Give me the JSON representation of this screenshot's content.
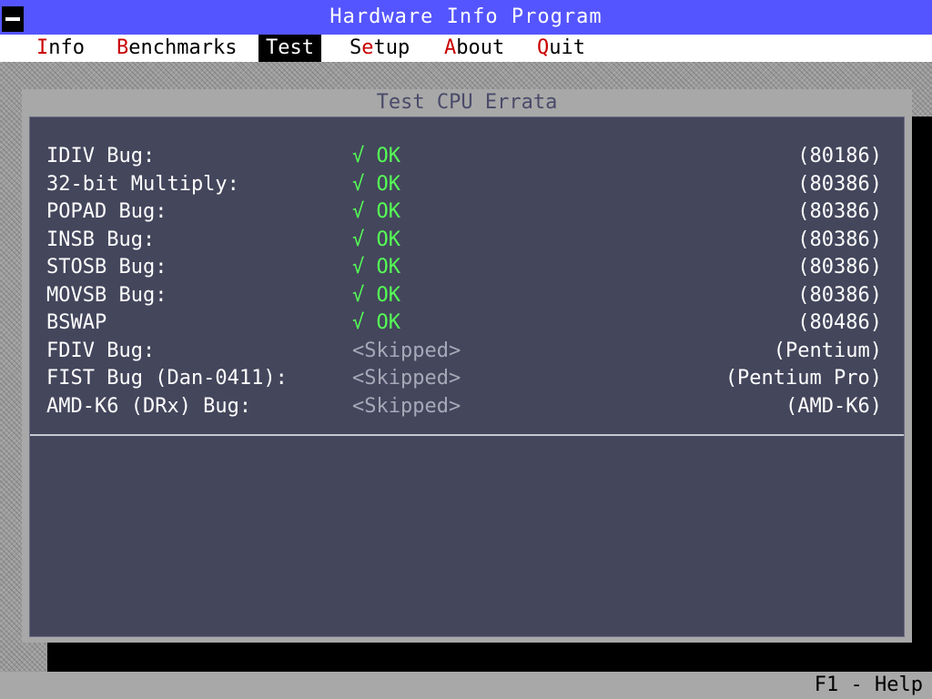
{
  "app": {
    "title": "Hardware Info Program"
  },
  "menu": [
    {
      "hot": "I",
      "rest": "nfo",
      "active": false
    },
    {
      "hot": "B",
      "rest": "enchmarks",
      "active": false
    },
    {
      "hot": "T",
      "rest": "est",
      "active": true
    },
    {
      "pre": "S",
      "hot": "e",
      "rest": "tup",
      "active": false
    },
    {
      "hot": "A",
      "rest": "bout",
      "active": false
    },
    {
      "hot": "Q",
      "rest": "uit",
      "active": false
    }
  ],
  "window": {
    "title": "Test CPU Errata"
  },
  "tests": [
    {
      "label": "IDIV Bug:",
      "status": "√ OK",
      "cpu": "(80186)"
    },
    {
      "label": "32-bit Multiply:",
      "status": "√ OK",
      "cpu": "(80386)"
    },
    {
      "label": "POPAD Bug:",
      "status": "√ OK",
      "cpu": "(80386)"
    },
    {
      "label": "INSB Bug:",
      "status": "√ OK",
      "cpu": "(80386)"
    },
    {
      "label": "STOSB Bug:",
      "status": "√ OK",
      "cpu": "(80386)"
    },
    {
      "label": "MOVSB Bug:",
      "status": "√ OK",
      "cpu": "(80386)"
    },
    {
      "label": "BSWAP",
      "status": "√ OK",
      "cpu": "(80486)"
    },
    {
      "label": "FDIV Bug:",
      "status": "<Skipped>",
      "cpu": "(Pentium)"
    },
    {
      "label": "FIST Bug (Dan-0411):",
      "status": "<Skipped>",
      "cpu": "(Pentium Pro)"
    },
    {
      "label": "AMD-K6 (DRx) Bug:",
      "status": "<Skipped>",
      "cpu": "(AMD-K6)"
    }
  ],
  "statusbar": {
    "help": "F1 - Help"
  },
  "colors": {
    "titlebar": "#5555ff",
    "panel": "#44465c",
    "ok": "#55ff55",
    "skipped": "#a8a8b8",
    "hotkey": "#c80000"
  }
}
